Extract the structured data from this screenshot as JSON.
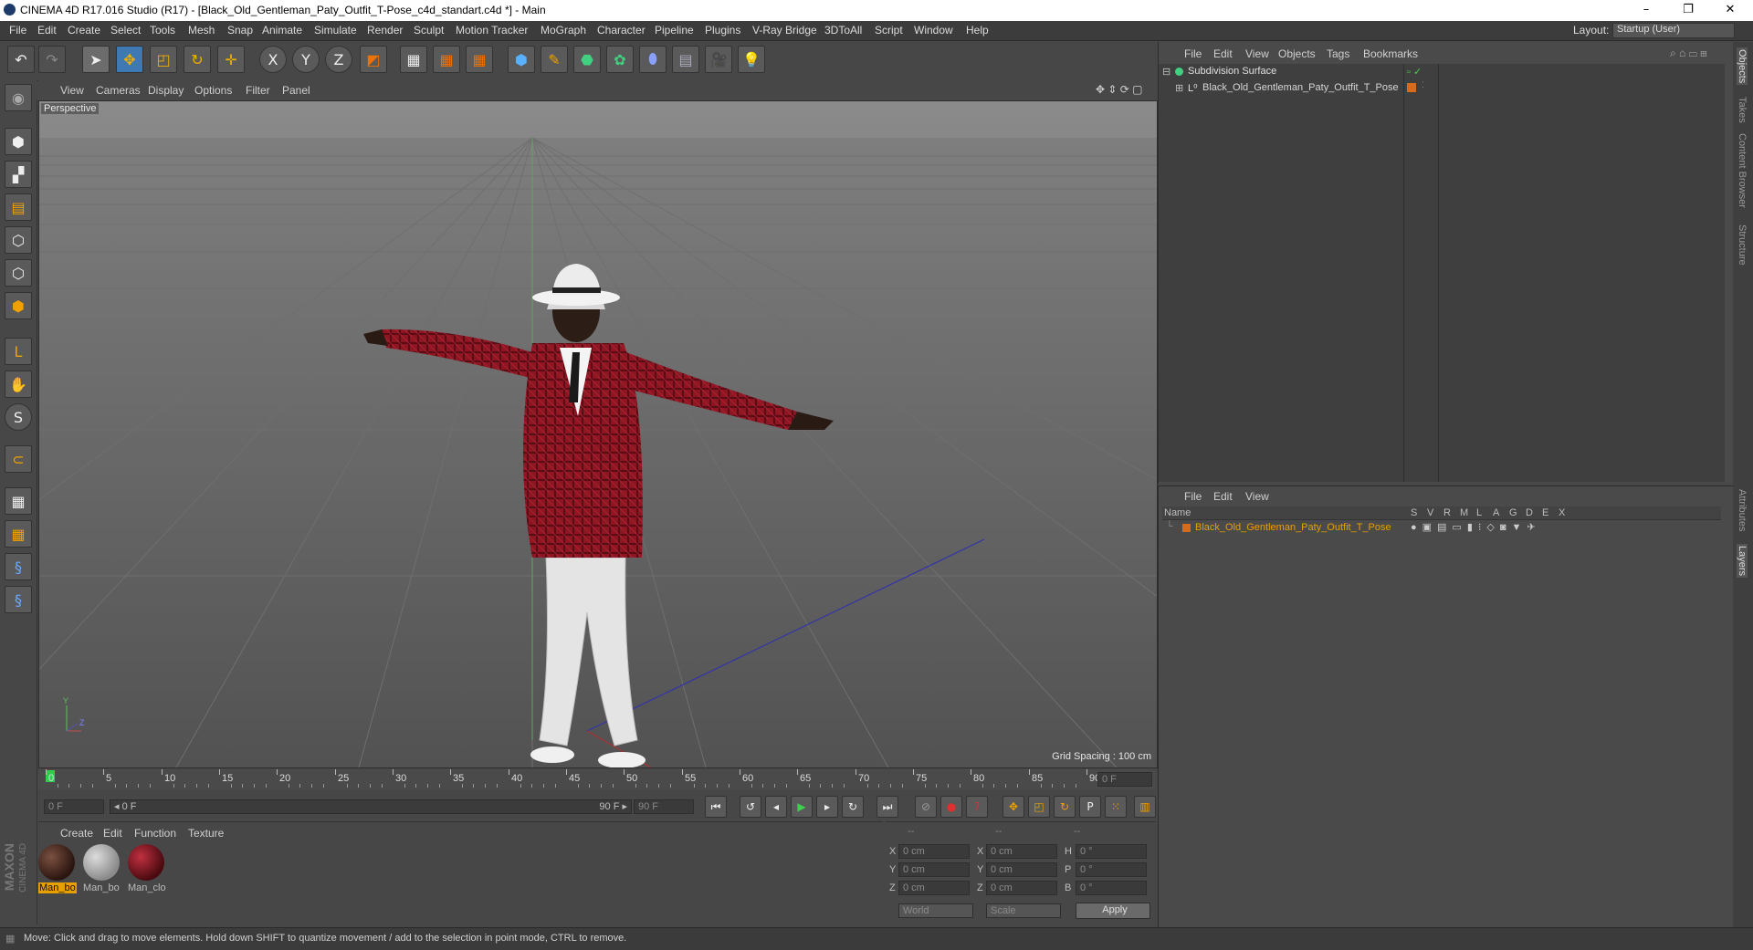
{
  "window": {
    "title": "CINEMA 4D R17.016 Studio (R17) - [Black_Old_Gentleman_Paty_Outfit_T-Pose_c4d_standart.c4d *] - Main",
    "minimize": "–",
    "restore": "❐",
    "close": "✕"
  },
  "menubar": [
    "File",
    "Edit",
    "Create",
    "Select",
    "Tools",
    "Mesh",
    "Snap",
    "Animate",
    "Simulate",
    "Render",
    "Sculpt",
    "Motion Tracker",
    "MoGraph",
    "Character",
    "Pipeline",
    "Plugins",
    "V-Ray Bridge",
    "3DToAll",
    "Script",
    "Window",
    "Help"
  ],
  "layout": {
    "label": "Layout:",
    "value": "Startup (User)"
  },
  "toolbar_axes": {
    "x": "X",
    "y": "Y",
    "z": "Z"
  },
  "viewport": {
    "menu": [
      "View",
      "Cameras",
      "Display",
      "Options",
      "Filter",
      "Panel"
    ],
    "label": "Perspective",
    "grid_spacing": "Grid Spacing : 100 cm"
  },
  "timeline": {
    "ticks": [
      "0",
      "5",
      "10",
      "15",
      "20",
      "25",
      "30",
      "35",
      "40",
      "45",
      "50",
      "55",
      "60",
      "65",
      "70",
      "75",
      "80",
      "85",
      "90"
    ],
    "current_frame_display": "0 F",
    "start_frame": "0 F",
    "range_start": "◂ 0 F",
    "range_end": "90 F ▸",
    "end_frame": "90 F"
  },
  "materials": {
    "menu": [
      "Create",
      "Edit",
      "Function",
      "Texture"
    ],
    "items": [
      {
        "label": "Man_bo",
        "selected": true
      },
      {
        "label": "Man_bo",
        "selected": false
      },
      {
        "label": "Man_clo",
        "selected": false
      }
    ]
  },
  "coordinates": {
    "headers": [
      "--",
      "--",
      "--"
    ],
    "rows": [
      {
        "a": "X",
        "av": "0 cm",
        "b": "X",
        "bv": "0 cm",
        "c": "H",
        "cv": "0 °"
      },
      {
        "a": "Y",
        "av": "0 cm",
        "b": "Y",
        "bv": "0 cm",
        "c": "P",
        "cv": "0 °"
      },
      {
        "a": "Z",
        "av": "0 cm",
        "b": "Z",
        "bv": "0 cm",
        "c": "B",
        "cv": "0 °"
      }
    ],
    "world": "World",
    "scale": "Scale",
    "apply": "Apply"
  },
  "objects_panel": {
    "menu": [
      "File",
      "Edit",
      "View",
      "Objects",
      "Tags",
      "Bookmarks"
    ],
    "items": [
      {
        "name": "Subdivision Surface"
      },
      {
        "name": "Black_Old_Gentleman_Paty_Outfit_T_Pose"
      }
    ]
  },
  "layers_panel": {
    "menu": [
      "File",
      "Edit",
      "View"
    ],
    "columns": [
      "Name",
      "S",
      "V",
      "R",
      "M",
      "L",
      "A",
      "G",
      "D",
      "E",
      "X"
    ],
    "rows": [
      {
        "name": "Black_Old_Gentleman_Paty_Outfit_T_Pose"
      }
    ]
  },
  "side_tabs": [
    "Objects",
    "Takes",
    "Content Browser",
    "Structure",
    "Attributes",
    "Layers"
  ],
  "brand": {
    "line1": "MAXON",
    "line2": "CINEMA 4D"
  },
  "status": "Move: Click and drag to move elements. Hold down SHIFT to quantize movement / add to the selection in point mode, CTRL to remove.",
  "colors": {
    "accent_orange": "#e8a000",
    "layer_orange": "#d86a1c",
    "selection_blue": "#3f79b3"
  }
}
